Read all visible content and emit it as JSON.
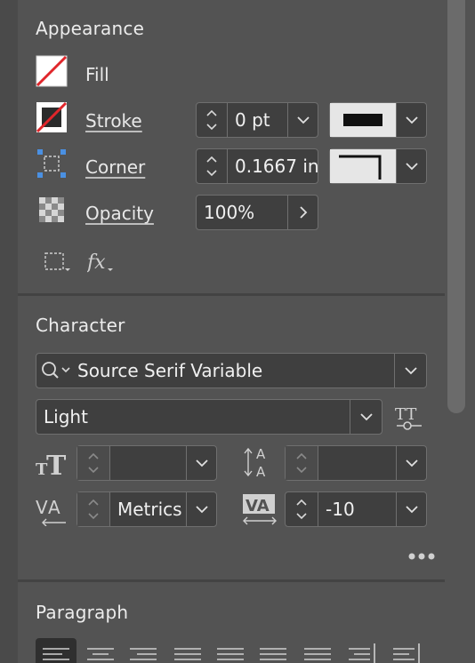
{
  "appearance": {
    "title": "Appearance",
    "fill_label": "Fill",
    "stroke_label": "Stroke",
    "stroke_weight": "0 pt",
    "corner_label": "Corner",
    "corner_value": "0.1667 in",
    "opacity_label": "Opacity",
    "opacity_value": "100%"
  },
  "character": {
    "title": "Character",
    "font_family": "Source Serif Variable",
    "font_style": "Light",
    "font_size": "",
    "leading": "",
    "kerning": "Metrics",
    "tracking": "-10"
  },
  "paragraph": {
    "title": "Paragraph"
  },
  "colors": {
    "panel_bg": "#535353",
    "field_bg": "#3f3f3f",
    "accent_blue": "#4a90e2",
    "slash_red": "#e0262b"
  }
}
